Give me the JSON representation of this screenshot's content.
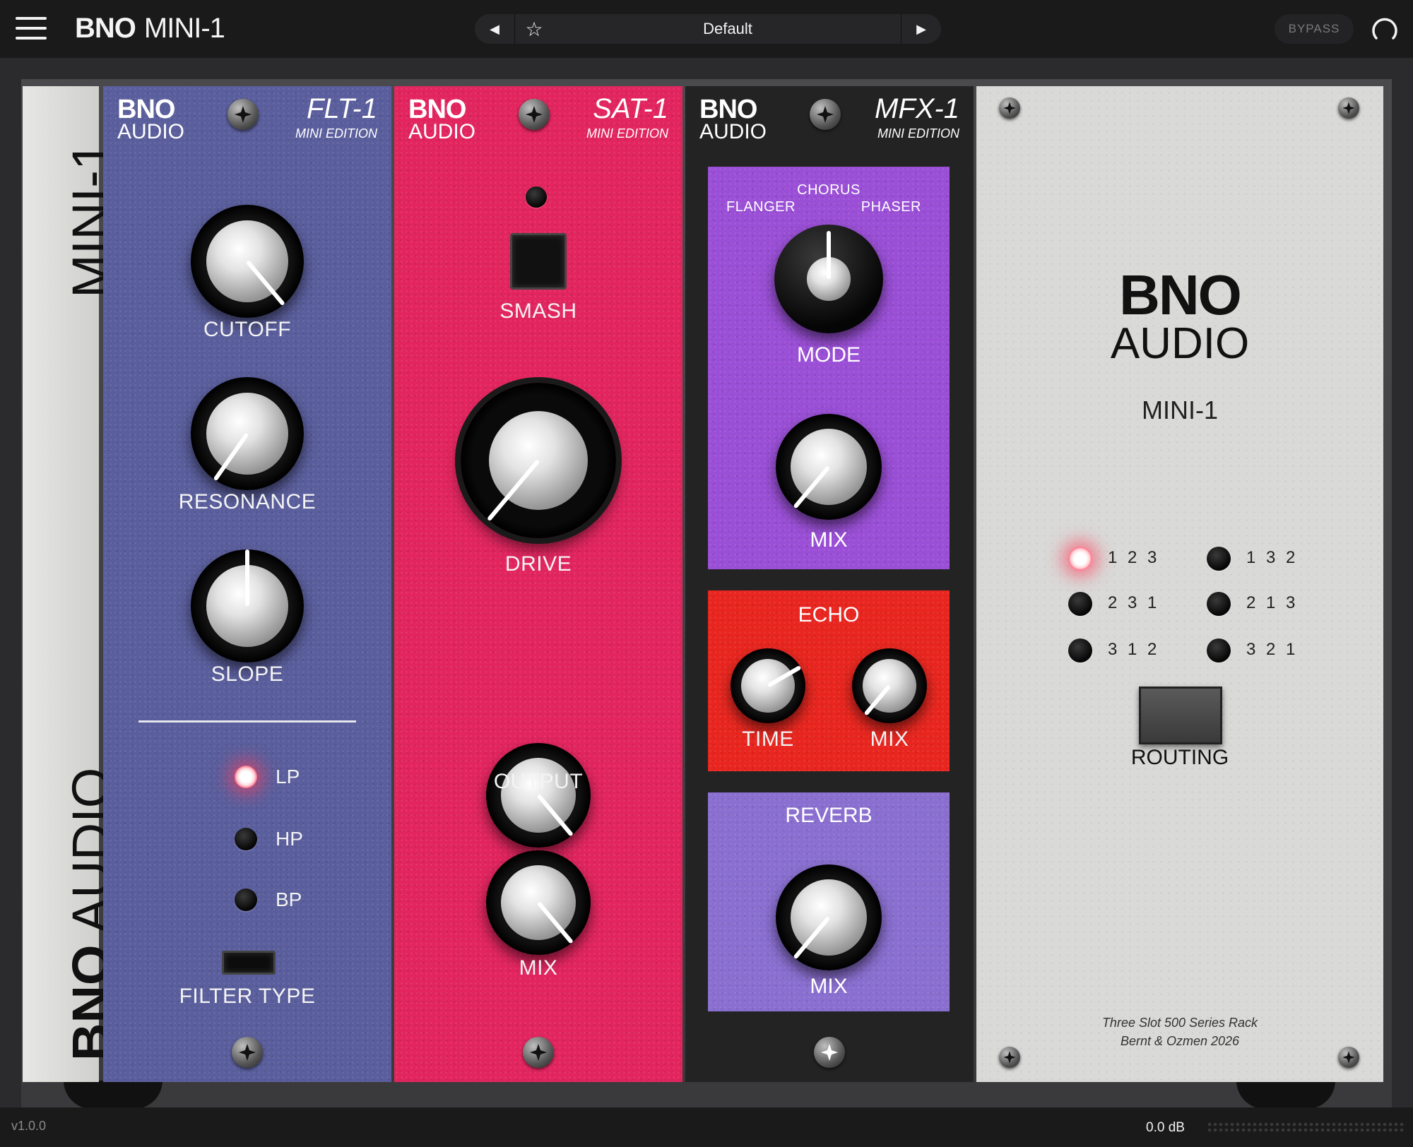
{
  "app": {
    "brand": "BNO",
    "name": "MINI-1"
  },
  "preset": {
    "name": "Default"
  },
  "header": {
    "bypass_label": "BYPASS"
  },
  "footer": {
    "version": "v1.0.0",
    "level": "0.0 dB"
  },
  "side_panel": {
    "top_text": "MINI-1",
    "bottom_brand": "BNO",
    "bottom_text": "AUDIO"
  },
  "modules": {
    "brand_top": "BNO",
    "brand_bottom": "AUDIO",
    "edition": "MINI EDITION",
    "flt": {
      "model": "FLT-1",
      "cutoff_label": "CUTOFF",
      "resonance_label": "RESONANCE",
      "slope_label": "SLOPE",
      "filter_type_label": "FILTER TYPE",
      "filter_types": [
        "LP",
        "HP",
        "BP"
      ],
      "active_filter": "LP"
    },
    "sat": {
      "model": "SAT-1",
      "smash_label": "SMASH",
      "drive_label": "DRIVE",
      "output_label": "OUTPUT",
      "mix_label": "MIX"
    },
    "mfx": {
      "model": "MFX-1",
      "modes": [
        "FLANGER",
        "CHORUS",
        "PHASER"
      ],
      "active_mode": "CHORUS",
      "mode_label": "MODE",
      "mod_mix_label": "MIX",
      "echo": {
        "title": "ECHO",
        "time_label": "TIME",
        "mix_label": "MIX"
      },
      "reverb": {
        "title": "REVERB",
        "mix_label": "MIX"
      }
    }
  },
  "brand_panel": {
    "brand": "BNO",
    "sub": "AUDIO",
    "model": "MINI-1",
    "routing_options": [
      "1 2 3",
      "1 3 2",
      "2 3 1",
      "2 1 3",
      "3 1 2",
      "3 2 1"
    ],
    "active_routing": "1 2 3",
    "routing_label": "ROUTING",
    "credit_line1": "Three Slot 500 Series Rack",
    "credit_line2": "Bernt & Ozmen 2026"
  },
  "colors": {
    "flt": "#5a5e9c",
    "sat": "#e2255f",
    "mfx_mod": "#9a4fd6",
    "echo": "#e8261f",
    "reverb": "#8a6fd0",
    "brand_panel": "#d9d9d7"
  }
}
